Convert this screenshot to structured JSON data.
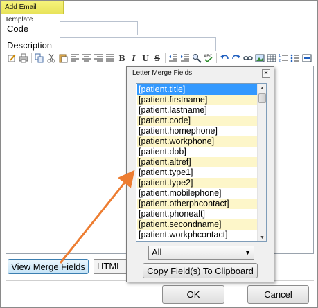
{
  "window": {
    "title": "Add Email Template"
  },
  "form": {
    "code_label": "Code",
    "code_value": "",
    "description_label": "Description",
    "description_value": ""
  },
  "toolbar": {
    "bold_label": "B",
    "italic_label": "I",
    "underline_label": "U",
    "strike_label": "S"
  },
  "buttons": {
    "view_merge_fields": "View Merge Fields",
    "html_tab": "HTML",
    "ok": "OK",
    "cancel": "Cancel"
  },
  "merge_popup": {
    "title": "Letter Merge Fields",
    "fields": [
      "[patient.title]",
      "[patient.firstname]",
      "[patient.lastname]",
      "[patient.code]",
      "[patient.homephone]",
      "[patient.workphone]",
      "[patient.dob]",
      "[patient.altref]",
      "[patient.type1]",
      "[patient.type2]",
      "[patient.mobilephone]",
      "[patient.otherphcontact]",
      "[patient.phonealt]",
      "[patient.secondname]",
      "[patient.workphcontact]"
    ],
    "selected_index": 0,
    "select_value": "All",
    "copy_button": "Copy Field(s) To Clipboard"
  },
  "colors": {
    "title_highlight": "#f6f37a",
    "list_alt_row": "#fdf6c9",
    "list_selected": "#3399ff",
    "annotation_arrow": "#ed7d31"
  }
}
